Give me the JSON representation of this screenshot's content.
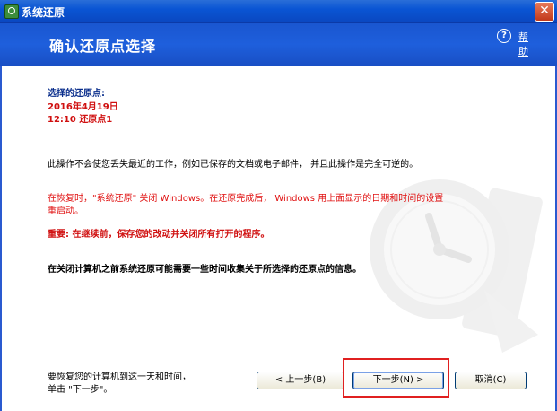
{
  "window": {
    "title": "系统还原",
    "close_label": "✕"
  },
  "header": {
    "heading": "确认还原点选择",
    "help_label": "帮助",
    "help_icon": "?"
  },
  "content": {
    "selected_label": "选择的还原点:",
    "selected_date": "2016年4月19日",
    "selected_point": "12:10 还原点1",
    "info_text": "此操作不会使您丢失最近的工作，例如已保存的文档或电子邮件， 并且此操作是完全可逆的。",
    "restart_line1": "在恢复时，\"系统还原\" 关闭 Windows。在还原完成后， Windows 用上面显示的日期和时间的设置",
    "restart_line2": "重启动。",
    "important_text": "重要: 在继续前，保存您的改动并关闭所有打开的程序。",
    "collect_text": "在关闭计算机之前系统还原可能需要一些时间收集关于所选择的还原点的信息。",
    "footer_line1": "要恢复您的计算机到这一天和时间，",
    "footer_line2": "单击 \"下一步\"。"
  },
  "buttons": {
    "back": "< 上一步(B)",
    "next": "下一步(N) >",
    "cancel": "取消(C)"
  },
  "colors": {
    "title_bar": "#0a55d4",
    "header": "#1e5fdc",
    "label_blue": "#0a2e8c",
    "warning_red": "#e01010",
    "highlight_red": "#e02020"
  }
}
